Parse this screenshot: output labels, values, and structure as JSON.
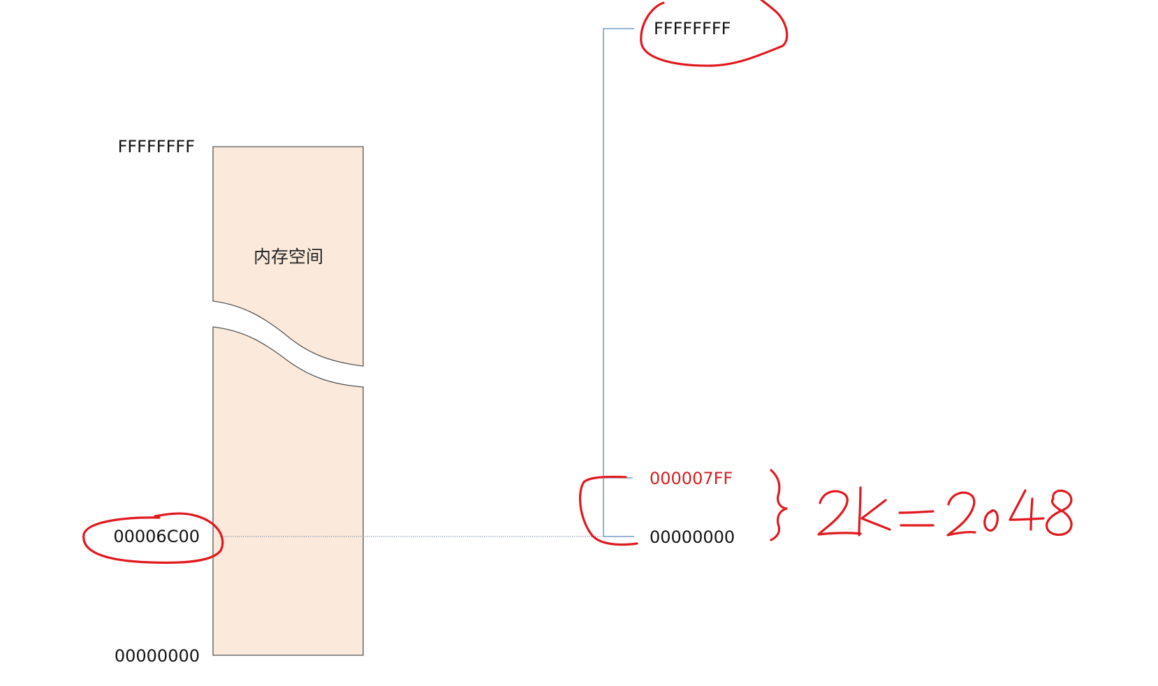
{
  "memory_block": {
    "label": "内存空间",
    "top_address": "FFFFFFFF",
    "bottom_address": "00000000",
    "marked_address": "00006C00",
    "fill_color": "#fbeadc",
    "border_color": "#555555"
  },
  "region_axis": {
    "top_address": "FFFFFFFF",
    "region_end_address": "000007FF",
    "region_start_address": "00000000",
    "axis_color": "#5b87c0",
    "highlight_color": "#d42020"
  },
  "handwriting": {
    "text": "2k=2048",
    "ink_color": "#e0191e"
  }
}
